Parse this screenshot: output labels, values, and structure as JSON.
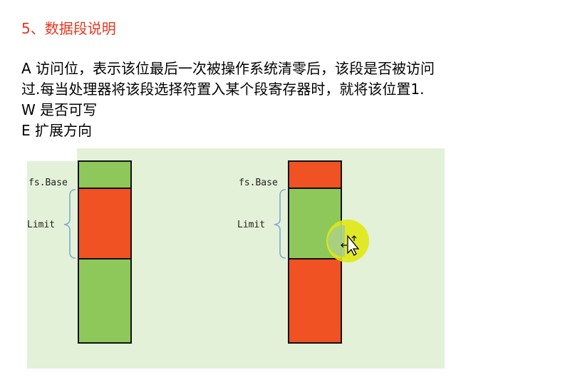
{
  "title": "5、数据段说明",
  "lines": [
    "A 访问位，表示该位最后一次被操作系统清零后，该段是否被访问",
    "过.每当处理器将该段选择符置入某个段寄存器时，就将该位置1.",
    "W 是否可写",
    "E 扩展方向"
  ],
  "diagram": {
    "left": {
      "base_label": "fs.Base",
      "limit_label": "Limit"
    },
    "right": {
      "base_label": "fs.Base",
      "limit_label": "Limit"
    }
  },
  "colors": {
    "title": "#e8361f",
    "green": "#8fc85a",
    "red": "#f05223",
    "panel": "#e3f1d8",
    "cursor_halo": "#e0e814"
  },
  "icons": [
    "move-cursor-icon"
  ]
}
